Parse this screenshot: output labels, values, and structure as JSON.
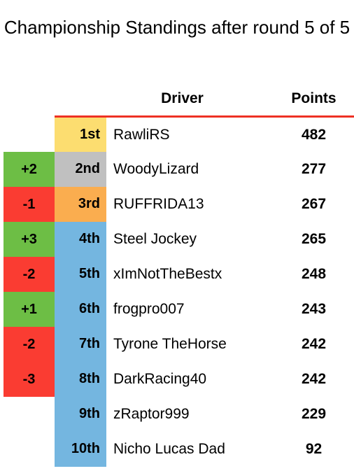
{
  "title": "Championship Standings after round 5 of 5",
  "round": {
    "current": 5,
    "total": 5
  },
  "colors": {
    "divider": "#ee3124",
    "gold": "#fcdd70",
    "silver": "#c0c0c0",
    "bronze": "#faad4f",
    "blue": "#74b6e0",
    "gain": "#6dbe45",
    "loss": "#fa3c32",
    "none": "#ffffff",
    "text": "#000000"
  },
  "table": {
    "headers": {
      "delta": "",
      "position": "",
      "driver": "Driver",
      "points": "Points"
    },
    "rows": [
      {
        "delta": "",
        "delta_type": "none",
        "position": "1st",
        "driver": "RawliRS",
        "points": "482"
      },
      {
        "delta": "+2",
        "delta_type": "gain",
        "position": "2nd",
        "driver": "WoodyLizard",
        "points": "277"
      },
      {
        "delta": "-1",
        "delta_type": "loss",
        "position": "3rd",
        "driver": "RUFFRIDA13",
        "points": "267"
      },
      {
        "delta": "+3",
        "delta_type": "gain",
        "position": "4th",
        "driver": "Steel Jockey",
        "points": "265"
      },
      {
        "delta": "-2",
        "delta_type": "loss",
        "position": "5th",
        "driver": "xImNotTheBestx",
        "points": "248"
      },
      {
        "delta": "+1",
        "delta_type": "gain",
        "position": "6th",
        "driver": "frogpro007",
        "points": "243"
      },
      {
        "delta": "-2",
        "delta_type": "loss",
        "position": "7th",
        "driver": "Tyrone TheHorse",
        "points": "242"
      },
      {
        "delta": "-3",
        "delta_type": "loss",
        "position": "8th",
        "driver": "DarkRacing40",
        "points": "242"
      },
      {
        "delta": "",
        "delta_type": "none",
        "position": "9th",
        "driver": "zRaptor999",
        "points": "229"
      },
      {
        "delta": "",
        "delta_type": "none",
        "position": "10th",
        "driver": "Nicho Lucas Dad",
        "points": "92"
      }
    ]
  }
}
